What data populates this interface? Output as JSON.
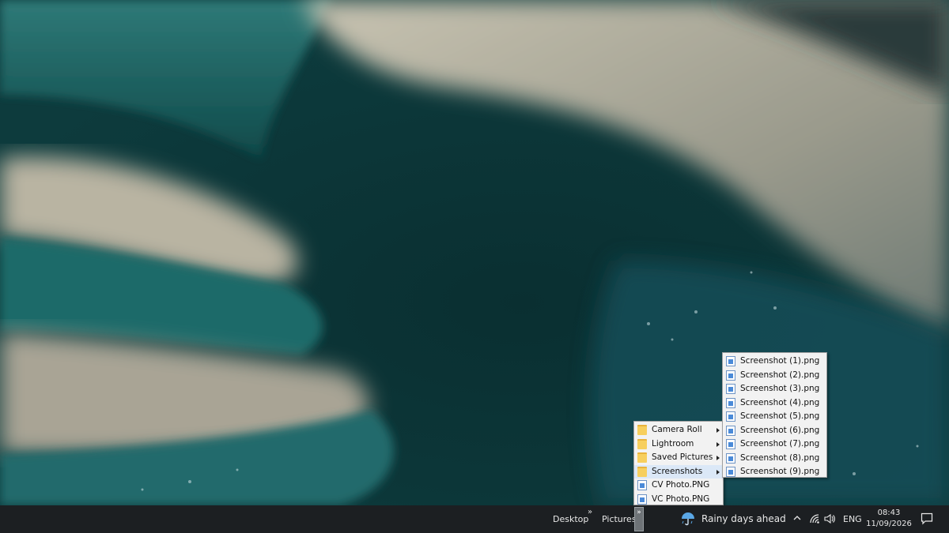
{
  "taskbar": {
    "toolbars": [
      {
        "label": "Desktop"
      },
      {
        "label": "Pictures"
      }
    ],
    "weather": {
      "text": "Rainy days ahead",
      "icon": "umbrella-rain-icon"
    },
    "language": "ENG",
    "clock": {
      "time": "08:43",
      "date": "11/09/2026"
    }
  },
  "pictures_menu": {
    "items": [
      {
        "label": "Camera Roll",
        "type": "folder",
        "submenu": true
      },
      {
        "label": "Lightroom",
        "type": "folder",
        "submenu": true
      },
      {
        "label": "Saved Pictures",
        "type": "folder",
        "submenu": true
      },
      {
        "label": "Screenshots",
        "type": "folder",
        "submenu": true,
        "highlighted": true
      },
      {
        "label": "CV Photo.PNG",
        "type": "file",
        "submenu": false
      },
      {
        "label": "VC Photo.PNG",
        "type": "file",
        "submenu": false
      }
    ]
  },
  "screenshots_menu": {
    "items": [
      {
        "label": "Screenshot (1).png"
      },
      {
        "label": "Screenshot (2).png"
      },
      {
        "label": "Screenshot (3).png"
      },
      {
        "label": "Screenshot (4).png"
      },
      {
        "label": "Screenshot (5).png"
      },
      {
        "label": "Screenshot (6).png"
      },
      {
        "label": "Screenshot (7).png"
      },
      {
        "label": "Screenshot (8).png"
      },
      {
        "label": "Screenshot (9).png"
      }
    ]
  },
  "colors": {
    "taskbar": "#1c1f22",
    "menu_bg": "#f2f2f2",
    "menu_highlight": "#dbe8f7"
  }
}
